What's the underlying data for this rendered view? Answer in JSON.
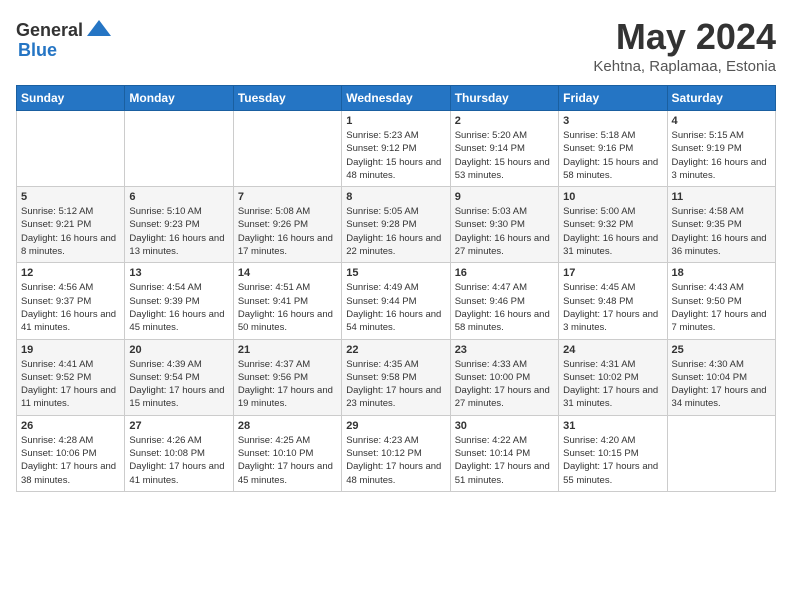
{
  "header": {
    "logo_general": "General",
    "logo_blue": "Blue",
    "month_year": "May 2024",
    "location": "Kehtna, Raplamaa, Estonia"
  },
  "weekdays": [
    "Sunday",
    "Monday",
    "Tuesday",
    "Wednesday",
    "Thursday",
    "Friday",
    "Saturday"
  ],
  "weeks": [
    [
      {
        "day": "",
        "sunrise": "",
        "sunset": "",
        "daylight": ""
      },
      {
        "day": "",
        "sunrise": "",
        "sunset": "",
        "daylight": ""
      },
      {
        "day": "",
        "sunrise": "",
        "sunset": "",
        "daylight": ""
      },
      {
        "day": "1",
        "sunrise": "5:23 AM",
        "sunset": "9:12 PM",
        "daylight": "15 hours and 48 minutes."
      },
      {
        "day": "2",
        "sunrise": "5:20 AM",
        "sunset": "9:14 PM",
        "daylight": "15 hours and 53 minutes."
      },
      {
        "day": "3",
        "sunrise": "5:18 AM",
        "sunset": "9:16 PM",
        "daylight": "15 hours and 58 minutes."
      },
      {
        "day": "4",
        "sunrise": "5:15 AM",
        "sunset": "9:19 PM",
        "daylight": "16 hours and 3 minutes."
      }
    ],
    [
      {
        "day": "5",
        "sunrise": "5:12 AM",
        "sunset": "9:21 PM",
        "daylight": "16 hours and 8 minutes."
      },
      {
        "day": "6",
        "sunrise": "5:10 AM",
        "sunset": "9:23 PM",
        "daylight": "16 hours and 13 minutes."
      },
      {
        "day": "7",
        "sunrise": "5:08 AM",
        "sunset": "9:26 PM",
        "daylight": "16 hours and 17 minutes."
      },
      {
        "day": "8",
        "sunrise": "5:05 AM",
        "sunset": "9:28 PM",
        "daylight": "16 hours and 22 minutes."
      },
      {
        "day": "9",
        "sunrise": "5:03 AM",
        "sunset": "9:30 PM",
        "daylight": "16 hours and 27 minutes."
      },
      {
        "day": "10",
        "sunrise": "5:00 AM",
        "sunset": "9:32 PM",
        "daylight": "16 hours and 31 minutes."
      },
      {
        "day": "11",
        "sunrise": "4:58 AM",
        "sunset": "9:35 PM",
        "daylight": "16 hours and 36 minutes."
      }
    ],
    [
      {
        "day": "12",
        "sunrise": "4:56 AM",
        "sunset": "9:37 PM",
        "daylight": "16 hours and 41 minutes."
      },
      {
        "day": "13",
        "sunrise": "4:54 AM",
        "sunset": "9:39 PM",
        "daylight": "16 hours and 45 minutes."
      },
      {
        "day": "14",
        "sunrise": "4:51 AM",
        "sunset": "9:41 PM",
        "daylight": "16 hours and 50 minutes."
      },
      {
        "day": "15",
        "sunrise": "4:49 AM",
        "sunset": "9:44 PM",
        "daylight": "16 hours and 54 minutes."
      },
      {
        "day": "16",
        "sunrise": "4:47 AM",
        "sunset": "9:46 PM",
        "daylight": "16 hours and 58 minutes."
      },
      {
        "day": "17",
        "sunrise": "4:45 AM",
        "sunset": "9:48 PM",
        "daylight": "17 hours and 3 minutes."
      },
      {
        "day": "18",
        "sunrise": "4:43 AM",
        "sunset": "9:50 PM",
        "daylight": "17 hours and 7 minutes."
      }
    ],
    [
      {
        "day": "19",
        "sunrise": "4:41 AM",
        "sunset": "9:52 PM",
        "daylight": "17 hours and 11 minutes."
      },
      {
        "day": "20",
        "sunrise": "4:39 AM",
        "sunset": "9:54 PM",
        "daylight": "17 hours and 15 minutes."
      },
      {
        "day": "21",
        "sunrise": "4:37 AM",
        "sunset": "9:56 PM",
        "daylight": "17 hours and 19 minutes."
      },
      {
        "day": "22",
        "sunrise": "4:35 AM",
        "sunset": "9:58 PM",
        "daylight": "17 hours and 23 minutes."
      },
      {
        "day": "23",
        "sunrise": "4:33 AM",
        "sunset": "10:00 PM",
        "daylight": "17 hours and 27 minutes."
      },
      {
        "day": "24",
        "sunrise": "4:31 AM",
        "sunset": "10:02 PM",
        "daylight": "17 hours and 31 minutes."
      },
      {
        "day": "25",
        "sunrise": "4:30 AM",
        "sunset": "10:04 PM",
        "daylight": "17 hours and 34 minutes."
      }
    ],
    [
      {
        "day": "26",
        "sunrise": "4:28 AM",
        "sunset": "10:06 PM",
        "daylight": "17 hours and 38 minutes."
      },
      {
        "day": "27",
        "sunrise": "4:26 AM",
        "sunset": "10:08 PM",
        "daylight": "17 hours and 41 minutes."
      },
      {
        "day": "28",
        "sunrise": "4:25 AM",
        "sunset": "10:10 PM",
        "daylight": "17 hours and 45 minutes."
      },
      {
        "day": "29",
        "sunrise": "4:23 AM",
        "sunset": "10:12 PM",
        "daylight": "17 hours and 48 minutes."
      },
      {
        "day": "30",
        "sunrise": "4:22 AM",
        "sunset": "10:14 PM",
        "daylight": "17 hours and 51 minutes."
      },
      {
        "day": "31",
        "sunrise": "4:20 AM",
        "sunset": "10:15 PM",
        "daylight": "17 hours and 55 minutes."
      },
      {
        "day": "",
        "sunrise": "",
        "sunset": "",
        "daylight": ""
      }
    ]
  ]
}
